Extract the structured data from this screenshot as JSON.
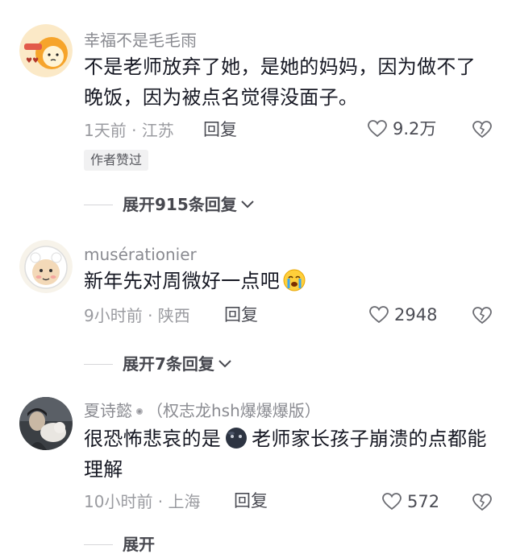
{
  "comments": [
    {
      "username": "幸福不是毛毛雨",
      "text": "不是老师放弃了她，是她的妈妈，因为做不了晚饭，因为被点名觉得没面子。",
      "time": "1天前 · 江苏",
      "reply_label": "回复",
      "likes": "9.2万",
      "badge": "作者赞过",
      "expand_label": "展开915条回复",
      "avatar_icon": "cartoon-avatar-icon"
    },
    {
      "username": "musérationier",
      "text": "新年先对周微好一点吧",
      "emoji": "crying-face-emoji",
      "time": "9小时前 · 陕西",
      "reply_label": "回复",
      "likes": "2948",
      "expand_label": "展开7条回复",
      "avatar_icon": "sheep-avatar-icon"
    },
    {
      "username": "夏诗懿",
      "username_suffix": "（权志龙hsh爆爆爆版）",
      "text_before": "很恐怖悲哀的是",
      "text_after": "老师家长孩子崩溃的点都能理解",
      "emoji": "dark-face-emoji",
      "time": "10小时前 · 上海",
      "reply_label": "回复",
      "likes": "572",
      "expand_label": "展开",
      "avatar_icon": "photo-avatar-icon"
    }
  ],
  "colors": {
    "text": "#161823",
    "meta": "#8a8b91",
    "accent_dark": "#4b4c54"
  }
}
